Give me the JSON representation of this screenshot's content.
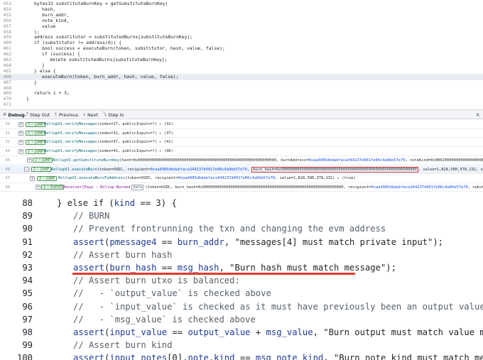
{
  "top_editor": {
    "lines": [
      {
        "n": "453",
        "code": "bytes32 substituteBurnKey = getSubstituteBurnKey(",
        "indent": 2
      },
      {
        "n": "454",
        "code": "hash,",
        "indent": 3
      },
      {
        "n": "455",
        "code": "burn_addr,",
        "indent": 3
      },
      {
        "n": "456",
        "code": "note_kind,",
        "indent": 3
      },
      {
        "n": "457",
        "code": "value",
        "indent": 3
      },
      {
        "n": "458",
        "code": ");",
        "indent": 2
      },
      {
        "n": "459",
        "code": "address substitutor = substitutedBurns[substituteBurnKey];",
        "indent": 2
      },
      {
        "n": "460",
        "code": "if (substitutor != address(0)) {",
        "indent": 2
      },
      {
        "n": "461",
        "code": "bool success = executeBurn(token, substitutor, hash, value, false);",
        "indent": 3
      },
      {
        "n": "462",
        "code": "if (success) {",
        "indent": 3
      },
      {
        "n": "463",
        "code": "delete substitutedBurns[substituteBurnKey];",
        "indent": 4
      },
      {
        "n": "464",
        "code": "}",
        "indent": 3
      },
      {
        "n": "465",
        "code": "} else {",
        "indent": 2
      },
      {
        "n": "466",
        "code": "executeBurn(token, burn_addr, hash, value, false);",
        "indent": 3
      },
      {
        "n": "467",
        "code": "}",
        "indent": 2
      },
      {
        "n": "468",
        "code": "",
        "indent": 0
      },
      {
        "n": "469",
        "code": "return i + 5;",
        "indent": 2
      },
      {
        "n": "470",
        "code": "}",
        "indent": 1
      },
      {
        "n": "471",
        "code": "",
        "indent": 0
      }
    ],
    "highlighted_line": "466"
  },
  "debug_bar": {
    "debug": "Debug",
    "step_out": "Step Out",
    "previous": "Previous",
    "next": "Next",
    "step_in": "Step In",
    "close": "×"
  },
  "trace": {
    "rows": [
      {
        "rn": "30",
        "jump": "1 ⚬ JUMP",
        "fn": "RollupV1.verifyMessages",
        "args": "(index=27, publicInputs=?)",
        "ret": "(32)"
      },
      {
        "rn": "31",
        "jump": "1 ⚬ JUMP",
        "fn": "RollupV1.verifyMessages",
        "args": "(index=32, publicInputs=?)",
        "ret": "(37)"
      },
      {
        "rn": "32",
        "jump": "1 ⚬ JUMP",
        "fn": "RollupV1.verifyMessages",
        "args": "(index=37, publicInputs=?)",
        "ret": "(41)"
      },
      {
        "rn": "44",
        "jump": "1 ⚬ JUMP",
        "fn": "RollupV1.verifyMessages",
        "args": "(index=41, publicInputs=?)",
        "ret": "(46)"
      },
      {
        "rn": "45",
        "jump": "2 ⚬ JUMP",
        "fn": "RollupV1.getSubstituteBurnKey",
        "args": "(hash=0x000000000000000000000000000000000000000000000000000000000000, burnAddress=",
        "addr": "0xaa4985dbdabfaca344237d4017e06c4a0bb57e70",
        "rest": ", noteKind=0x00020000000000000000893c499"
      },
      {
        "rn": "46",
        "jump": "2 ⚬ JUMP",
        "fn": "RollupV1.executeBurn",
        "args": "(token=USDC, recipient=",
        "addr": "0xaa4985dbdabfaca344237d4017e06c4a0bb57e70",
        "boxed": "burn_hash=0x00000000000000000000000000000000000000000000000000000000000",
        "rest": ", value=1,828,580,378,132, subst"
      },
      {
        "rn": "47",
        "jump": "3 ⚬ JUMP",
        "fn": "RollupV1.executeBurnToAddress",
        "args": "(token=USDC, recipient=",
        "addr": "0xaa4985dbdabfaca344237d4017e06c4a0bb57e70",
        "rest": ", value=1,828,580,378,132)",
        "ret": "(true)"
      },
      {
        "rn": "48",
        "jump": "3 ⚬ EVENT",
        "fn": "[Receiver]Payy : Rollup.Burned",
        "badge": "data",
        "args": "(token=USDC, burn_hash=0x0000000000000000000000000000000000000000000000000000000000000, recipient=",
        "addr": "0xaa4985dbdabfaca344237d4017e06c4a0bb57e70",
        "rest": ", substitute"
      }
    ]
  },
  "bottom_code": {
    "lines": [
      {
        "n": "88",
        "indent": 0,
        "parts": [
          [
            "p",
            "} else if ("
          ],
          [
            "f",
            "kind"
          ],
          [
            "p",
            " == 3) {"
          ]
        ]
      },
      {
        "n": "89",
        "indent": 1,
        "parts": [
          [
            "c",
            "// BURN"
          ]
        ]
      },
      {
        "n": "90",
        "indent": 1,
        "parts": [
          [
            "c",
            "// Prevent frontrunning the txn and changing the evm address"
          ]
        ]
      },
      {
        "n": "91",
        "indent": 1,
        "parts": [
          [
            "f",
            "assert"
          ],
          [
            "p",
            "("
          ],
          [
            "f",
            "pmessage4"
          ],
          [
            "p",
            " == "
          ],
          [
            "f",
            "burn_addr"
          ],
          [
            "p",
            ", \"messages[4] must match private input\");"
          ]
        ]
      },
      {
        "n": "92",
        "indent": 1,
        "parts": [
          [
            "c",
            "// Assert burn hash"
          ]
        ]
      },
      {
        "n": "93",
        "indent": 1,
        "parts": [
          [
            "f",
            "assert"
          ],
          [
            "p",
            "("
          ],
          [
            "f",
            "burn_hash"
          ],
          [
            "p",
            " == "
          ],
          [
            "f",
            "msg_hash"
          ],
          [
            "p",
            ", \"Burn hash must match message\");"
          ]
        ]
      },
      {
        "n": "94",
        "indent": 1,
        "parts": [
          [
            "c",
            "// Assert burn utxo is balanced:"
          ]
        ]
      },
      {
        "n": "95",
        "indent": 1,
        "parts": [
          [
            "c",
            "//   - `output_value` is checked above"
          ]
        ]
      },
      {
        "n": "96",
        "indent": 1,
        "parts": [
          [
            "c",
            "//   - `input_value` is checked as it must have previously been an output value"
          ]
        ]
      },
      {
        "n": "97",
        "indent": 1,
        "parts": [
          [
            "c",
            "//   - `msg_value` is checked above"
          ]
        ]
      },
      {
        "n": "98",
        "indent": 1,
        "parts": [
          [
            "f",
            "assert"
          ],
          [
            "p",
            "("
          ],
          [
            "f",
            "input_value"
          ],
          [
            "p",
            " == "
          ],
          [
            "f",
            "output_value"
          ],
          [
            "p",
            " + "
          ],
          [
            "f",
            "msg_value"
          ],
          [
            "p",
            ", \"Burn output must match value message\");"
          ]
        ]
      },
      {
        "n": "99",
        "indent": 1,
        "parts": [
          [
            "c",
            "// Assert burn kind"
          ]
        ]
      },
      {
        "n": "100",
        "indent": 1,
        "parts": [
          [
            "f",
            "assert"
          ],
          [
            "p",
            "("
          ],
          [
            "f",
            "input_notes"
          ],
          [
            "p",
            "[0]."
          ],
          [
            "f",
            "note"
          ],
          [
            "p",
            "."
          ],
          [
            "f",
            "kind"
          ],
          [
            "p",
            " == "
          ],
          [
            "f",
            "msg_note_kind"
          ],
          [
            "p",
            ", \"Burn note kind must match message\")"
          ]
        ]
      }
    ]
  },
  "colors": {
    "accent_underline": "#e03a2f",
    "jump_green": "#2f7d3a",
    "address_blue": "#1750eb"
  }
}
